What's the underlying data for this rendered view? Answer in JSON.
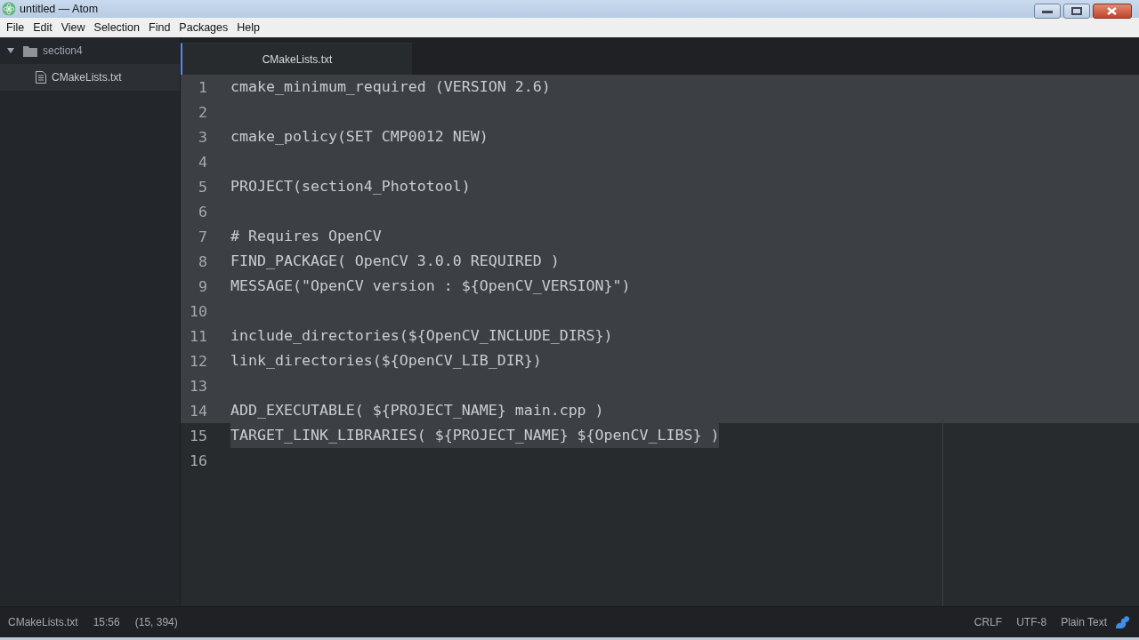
{
  "window": {
    "title": "untitled — Atom"
  },
  "menu": [
    "File",
    "Edit",
    "View",
    "Selection",
    "Find",
    "Packages",
    "Help"
  ],
  "tree_view": {
    "folder": {
      "name": "section4",
      "expanded": true,
      "children": [
        {
          "name": "CMakeLists.txt",
          "selected": true
        }
      ]
    }
  },
  "tabs": [
    {
      "label": "CMakeLists.txt",
      "selected": true
    }
  ],
  "editor": {
    "lines": [
      {
        "number": "1",
        "text": "cmake_minimum_required (VERSION 2.6)",
        "selected": true
      },
      {
        "number": "2",
        "selected": true
      },
      {
        "number": "3",
        "text": "cmake_policy(SET CMP0012 NEW)",
        "selected": true
      },
      {
        "number": "4",
        "selected": true
      },
      {
        "number": "5",
        "text": "PROJECT(section4_Phototool)",
        "selected": true
      },
      {
        "number": "6",
        "selected": true
      },
      {
        "number": "7",
        "text": "# Requires OpenCV",
        "selected": true
      },
      {
        "number": "8",
        "text": "FIND_PACKAGE( OpenCV 3.0.0 REQUIRED )",
        "selected": true
      },
      {
        "number": "9",
        "text": "MESSAGE(\"OpenCV version : ${OpenCV_VERSION}\")",
        "selected": true
      },
      {
        "number": "10",
        "selected": true
      },
      {
        "number": "11",
        "text": "include_directories(${OpenCV_INCLUDE_DIRS})",
        "selected": true
      },
      {
        "number": "12",
        "text": "link_directories(${OpenCV_LIB_DIR})",
        "selected": true
      },
      {
        "number": "13",
        "selected": true
      },
      {
        "number": "14",
        "text": "ADD_EXECUTABLE( ${PROJECT_NAME} main.cpp )",
        "selected": true
      },
      {
        "number": "15",
        "text": "TARGET_LINK_LIBRARIES( ${PROJECT_NAME} ${OpenCV_LIBS} )",
        "selected": true
      },
      {
        "number": "16",
        "selected": false
      }
    ]
  },
  "status_bar": {
    "left": [
      "CMakeLists.txt",
      "15:56",
      "(15, 394)"
    ],
    "right": [
      "CRLF",
      "UTF-8",
      "Plain Text"
    ]
  }
}
